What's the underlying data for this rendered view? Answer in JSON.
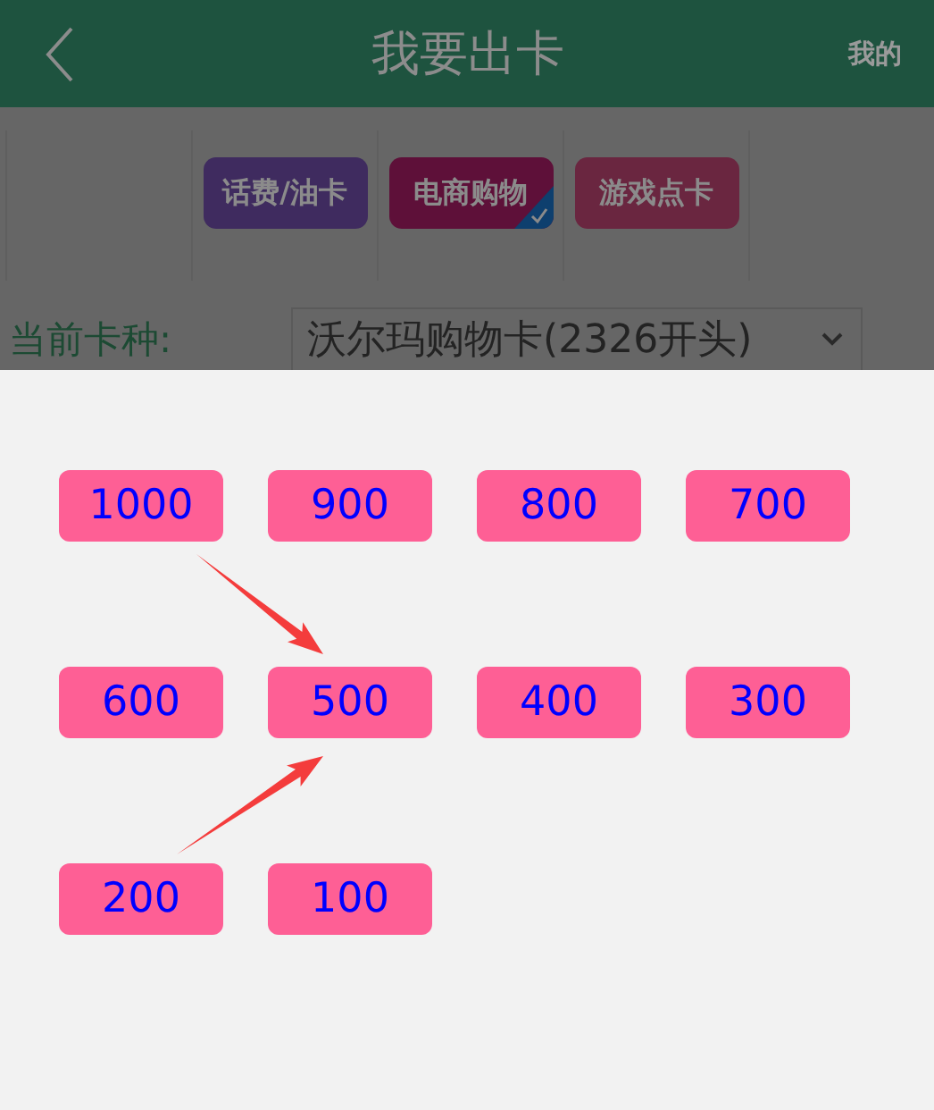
{
  "header": {
    "title": "我要出卡",
    "right_link": "我的"
  },
  "categories": [
    {
      "label": "话费/油卡",
      "color": "#3f2b5f",
      "selected": false
    },
    {
      "label": "电商购物",
      "color": "#5e1039",
      "selected": true
    },
    {
      "label": "游戏点卡",
      "color": "#6a2640",
      "selected": false
    }
  ],
  "card_type": {
    "label": "当前卡种:",
    "value": "沃尔玛购物卡(2326开头)"
  },
  "amounts": [
    {
      "label": "1000"
    },
    {
      "label": "900"
    },
    {
      "label": "800"
    },
    {
      "label": "700"
    },
    {
      "label": "600"
    },
    {
      "label": "500",
      "annotation": {
        "kind": "two_arrows"
      }
    },
    {
      "label": "400"
    },
    {
      "label": "300"
    },
    {
      "label": "200"
    },
    {
      "label": "100"
    }
  ]
}
